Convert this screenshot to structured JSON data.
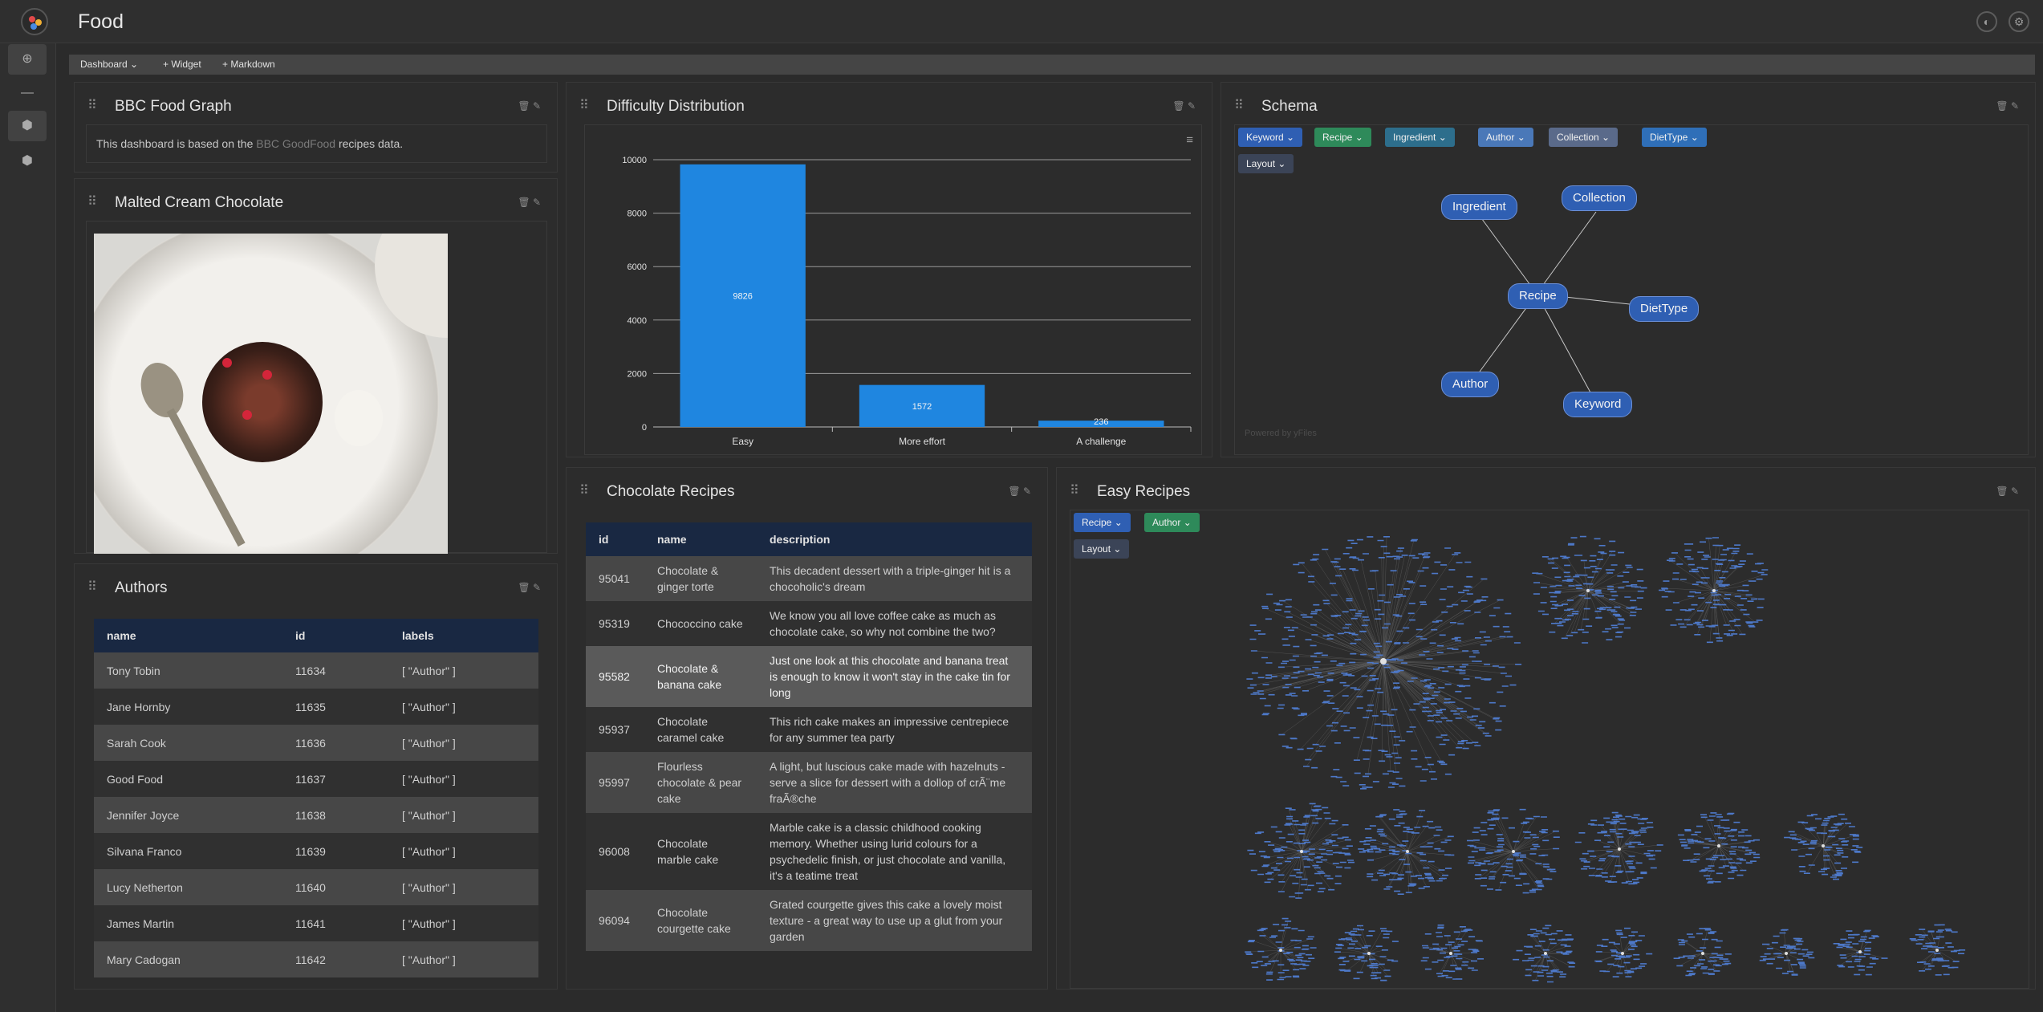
{
  "app": {
    "title": "Food"
  },
  "toolbar": {
    "dashboard": "Dashboard",
    "add_widget": "+ Widget",
    "add_markdown": "+ Markdown"
  },
  "panels": {
    "bbc": {
      "title": "BBC Food Graph",
      "text_before": "This dashboard is based on the ",
      "link": "BBC GoodFood",
      "text_after": " recipes data."
    },
    "malted": {
      "title": "Malted Cream Chocolate"
    },
    "authors": {
      "title": "Authors",
      "columns": [
        "name",
        "id",
        "labels"
      ],
      "rows": [
        [
          "Tony Tobin",
          "11634",
          "[ \"Author\" ]"
        ],
        [
          "Jane Hornby",
          "11635",
          "[ \"Author\" ]"
        ],
        [
          "Sarah Cook",
          "11636",
          "[ \"Author\" ]"
        ],
        [
          "Good Food",
          "11637",
          "[ \"Author\" ]"
        ],
        [
          "Jennifer Joyce",
          "11638",
          "[ \"Author\" ]"
        ],
        [
          "Silvana Franco",
          "11639",
          "[ \"Author\" ]"
        ],
        [
          "Lucy Netherton",
          "11640",
          "[ \"Author\" ]"
        ],
        [
          "James Martin",
          "11641",
          "[ \"Author\" ]"
        ],
        [
          "Mary Cadogan",
          "11642",
          "[ \"Author\" ]"
        ]
      ]
    },
    "difficulty": {
      "title": "Difficulty Distribution"
    },
    "schema": {
      "title": "Schema",
      "chips": [
        {
          "label": "Keyword",
          "color": "#2f5fb3"
        },
        {
          "label": "Recipe",
          "color": "#2e8a5a"
        },
        {
          "label": "Ingredient",
          "color": "#2d6e8c"
        },
        {
          "label": "Author",
          "color": "#4a78b8"
        },
        {
          "label": "Collection",
          "color": "#5a6a8a"
        },
        {
          "label": "DietType",
          "color": "#2f6fb8"
        }
      ],
      "layout": "Layout",
      "nodes": [
        "Ingredient",
        "Collection",
        "Recipe",
        "DietType",
        "Author",
        "Keyword"
      ],
      "powered": "Powered by yFiles"
    },
    "chocolate": {
      "title": "Chocolate Recipes",
      "columns": [
        "id",
        "name",
        "description"
      ],
      "rows": [
        [
          "95041",
          "Chocolate & ginger torte",
          "This decadent dessert with a triple-ginger hit is a chocoholic's dream"
        ],
        [
          "95319",
          "Chococcino cake",
          "We know you all love coffee cake as much as chocolate cake, so why not combine the two?"
        ],
        [
          "95582",
          "Chocolate & banana cake",
          "Just one look at this chocolate and banana treat is enough to know it won't stay in the cake tin for long"
        ],
        [
          "95937",
          "Chocolate caramel cake",
          "This rich cake makes an impressive centrepiece for any summer tea party"
        ],
        [
          "95997",
          "Flourless chocolate & pear cake",
          "A light, but luscious cake made with hazelnuts - serve a slice for dessert with a dollop of crÃ¨me fraÃ®che"
        ],
        [
          "96008",
          "Chocolate marble cake",
          "Marble cake is a classic childhood cooking memory. Whether using lurid colours for a psychedelic finish, or just chocolate and vanilla, it's a teatime treat"
        ],
        [
          "96094",
          "Chocolate courgette cake",
          "Grated courgette gives this cake a lovely moist texture - a great way to use up a glut from your garden"
        ]
      ]
    },
    "easy": {
      "title": "Easy Recipes",
      "chips": [
        {
          "label": "Recipe",
          "color": "#2f5fb3"
        },
        {
          "label": "Author",
          "color": "#2e8a5a"
        }
      ],
      "layout": "Layout"
    }
  },
  "chart_data": {
    "type": "bar",
    "categories": [
      "Easy",
      "More effort",
      "A challenge"
    ],
    "values": [
      9826,
      1572,
      236
    ],
    "ylim": [
      0,
      10000
    ],
    "yticks": [
      0,
      2000,
      4000,
      6000,
      8000,
      10000
    ],
    "bar_color": "#1f86e0",
    "grid": true,
    "title": "",
    "xlabel": "",
    "ylabel": ""
  }
}
